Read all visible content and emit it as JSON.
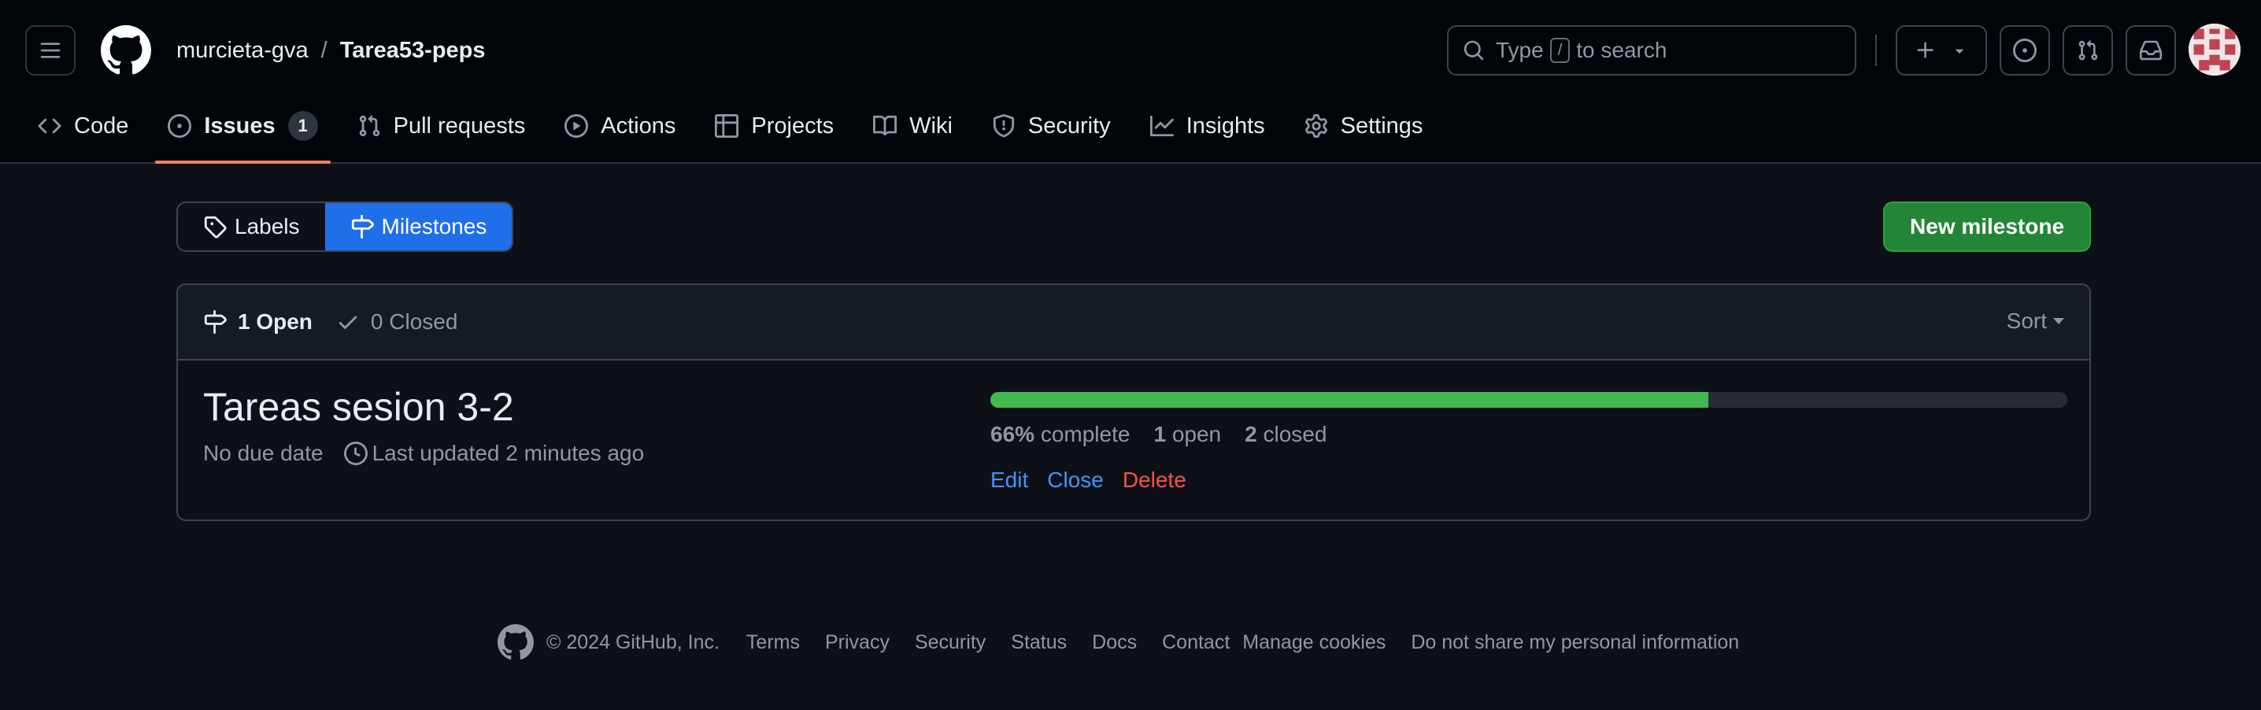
{
  "header": {
    "owner": "murcieta-gva",
    "separator": "/",
    "repo": "Tarea53-peps",
    "search": {
      "before": "Type",
      "key": "/",
      "after": "to search"
    }
  },
  "tabs": [
    {
      "label": "Code",
      "icon": "code-icon"
    },
    {
      "label": "Issues",
      "icon": "issue-opened-icon",
      "count": "1",
      "active": true
    },
    {
      "label": "Pull requests",
      "icon": "git-pull-request-icon"
    },
    {
      "label": "Actions",
      "icon": "play-icon"
    },
    {
      "label": "Projects",
      "icon": "table-icon"
    },
    {
      "label": "Wiki",
      "icon": "book-icon"
    },
    {
      "label": "Security",
      "icon": "shield-icon"
    },
    {
      "label": "Insights",
      "icon": "graph-icon"
    },
    {
      "label": "Settings",
      "icon": "gear-icon"
    }
  ],
  "subnav": {
    "labels": "Labels",
    "milestones": "Milestones",
    "new_milestone": "New milestone"
  },
  "list": {
    "open": "1 Open",
    "closed": "0 Closed",
    "sort": "Sort"
  },
  "milestone": {
    "title": "Tareas sesion 3-2",
    "due": "No due date",
    "updated": "Last updated 2 minutes ago",
    "progress_fraction": 0.667,
    "percent": "66%",
    "percent_suffix": "complete",
    "open_count": "1",
    "open_label": "open",
    "closed_count": "2",
    "closed_label": "closed",
    "edit": "Edit",
    "close": "Close",
    "delete": "Delete"
  },
  "footer": {
    "copyright": "© 2024 GitHub, Inc.",
    "links": [
      "Terms",
      "Privacy",
      "Security",
      "Status",
      "Docs",
      "Contact",
      "Manage cookies",
      "Do not share my personal information"
    ]
  },
  "colors": {
    "background": "#0d1117",
    "header": "#010409",
    "accent_blue": "#1f6feb",
    "green": "#238636",
    "progress": "#3fb950",
    "danger": "#f85149",
    "link": "#4493f8",
    "tab_underline": "#f78166"
  }
}
